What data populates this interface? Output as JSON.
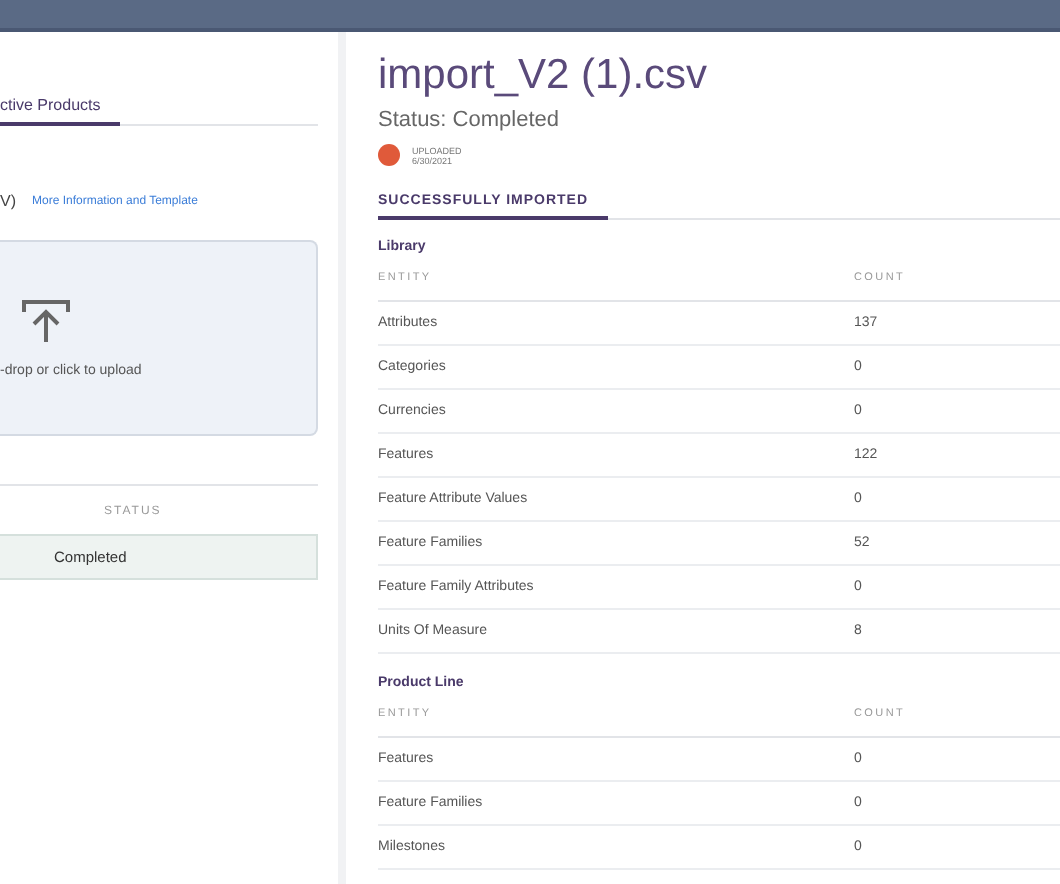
{
  "left_panel": {
    "tabs": [
      {
        "label": "ctive Products",
        "selected": true
      }
    ],
    "template_note": {
      "prefix": "V)",
      "link": "More Information and Template"
    },
    "upload": {
      "label": "-drop or click to upload"
    },
    "table": {
      "columns": [
        "STATUS"
      ],
      "rows": [
        {
          "status": "Completed",
          "selected": true
        }
      ]
    }
  },
  "detail": {
    "title": "import_V2 (1).csv",
    "status": "Status: Completed",
    "uploaded_label": "UPLOADED",
    "uploaded_date": "6/30/2021",
    "tabs": [
      {
        "label": "SUCCESSFULLY IMPORTED",
        "selected": true
      }
    ],
    "sections": [
      {
        "title": "Library",
        "columns": [
          "ENTITY",
          "COUNT"
        ],
        "rows": [
          {
            "entity": "Attributes",
            "count": "137"
          },
          {
            "entity": "Categories",
            "count": "0"
          },
          {
            "entity": "Currencies",
            "count": "0"
          },
          {
            "entity": "Features",
            "count": "122"
          },
          {
            "entity": "Feature Attribute Values",
            "count": "0"
          },
          {
            "entity": "Feature Families",
            "count": "52"
          },
          {
            "entity": "Feature Family Attributes",
            "count": "0"
          },
          {
            "entity": "Units Of Measure",
            "count": "8"
          }
        ]
      },
      {
        "title": "Product Line",
        "columns": [
          "ENTITY",
          "COUNT"
        ],
        "rows": [
          {
            "entity": "Features",
            "count": "0"
          },
          {
            "entity": "Feature Families",
            "count": "0"
          },
          {
            "entity": "Milestones",
            "count": "0"
          }
        ]
      }
    ]
  }
}
